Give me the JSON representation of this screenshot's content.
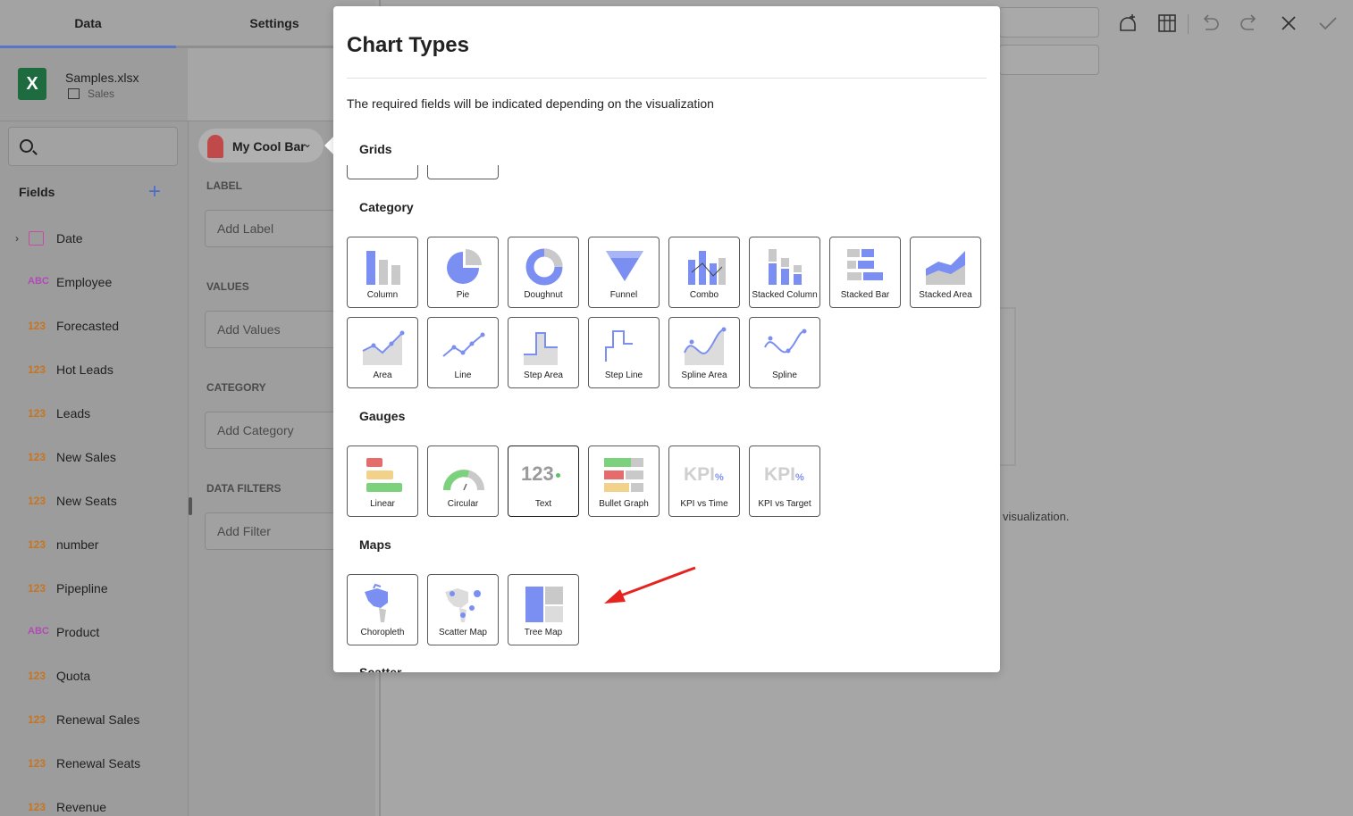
{
  "tabs": {
    "data": "Data",
    "settings": "Settings"
  },
  "file": {
    "name": "Samples.xlsx",
    "sheet": "Sales",
    "icon": "excel-icon"
  },
  "fields": {
    "title": "Fields",
    "items": [
      {
        "type": "date",
        "name": "Date"
      },
      {
        "type": "ABC",
        "name": "Employee"
      },
      {
        "type": "123",
        "name": "Forecasted"
      },
      {
        "type": "123",
        "name": "Hot Leads"
      },
      {
        "type": "123",
        "name": "Leads"
      },
      {
        "type": "123",
        "name": "New Sales"
      },
      {
        "type": "123",
        "name": "New Seats"
      },
      {
        "type": "123",
        "name": "number"
      },
      {
        "type": "123",
        "name": "Pipepline"
      },
      {
        "type": "ABC",
        "name": "Product"
      },
      {
        "type": "123",
        "name": "Quota"
      },
      {
        "type": "123",
        "name": "Renewal Sales"
      },
      {
        "type": "123",
        "name": "Renewal Seats"
      },
      {
        "type": "123",
        "name": "Revenue"
      }
    ]
  },
  "editor": {
    "viz_name": "My Cool Bar",
    "label_section": "LABEL",
    "label_placeholder": "Add Label",
    "values_section": "VALUES",
    "values_placeholder": "Add Values",
    "category_section": "CATEGORY",
    "category_placeholder": "Add Category",
    "filters_section": "DATA FILTERS",
    "filters_placeholder": "Add Filter"
  },
  "background_hint": "visualization.",
  "toolbar": [
    "add-widget-icon",
    "table-icon",
    "undo-icon",
    "redo-icon",
    "close-icon",
    "check-icon"
  ],
  "modal": {
    "title": "Chart Types",
    "subtitle": "The required fields will be indicated depending on the visualization",
    "groups": {
      "grids": "Grids",
      "category": "Category",
      "gauges": "Gauges",
      "maps": "Maps",
      "scatter": "Scatter"
    },
    "category_tiles": [
      "Column",
      "Pie",
      "Doughnut",
      "Funnel",
      "Combo",
      "Stacked Column",
      "Stacked Bar",
      "Stacked Area",
      "Area",
      "Line",
      "Step Area",
      "Step Line",
      "Spline Area",
      "Spline"
    ],
    "gauge_tiles": [
      "Linear",
      "Circular",
      "Text",
      "Bullet Graph",
      "KPI vs Time",
      "KPI vs Target"
    ],
    "map_tiles": [
      "Choropleth",
      "Scatter Map",
      "Tree Map"
    ],
    "text_tile_glyph": "123",
    "kpi_glyph": "KPI",
    "kpi_pct": "%",
    "selected_gauge": "Text"
  },
  "colors": {
    "accent": "#7b8ff2",
    "annotation_arrow": "#e5231f",
    "gray": "#c9c9c9"
  }
}
